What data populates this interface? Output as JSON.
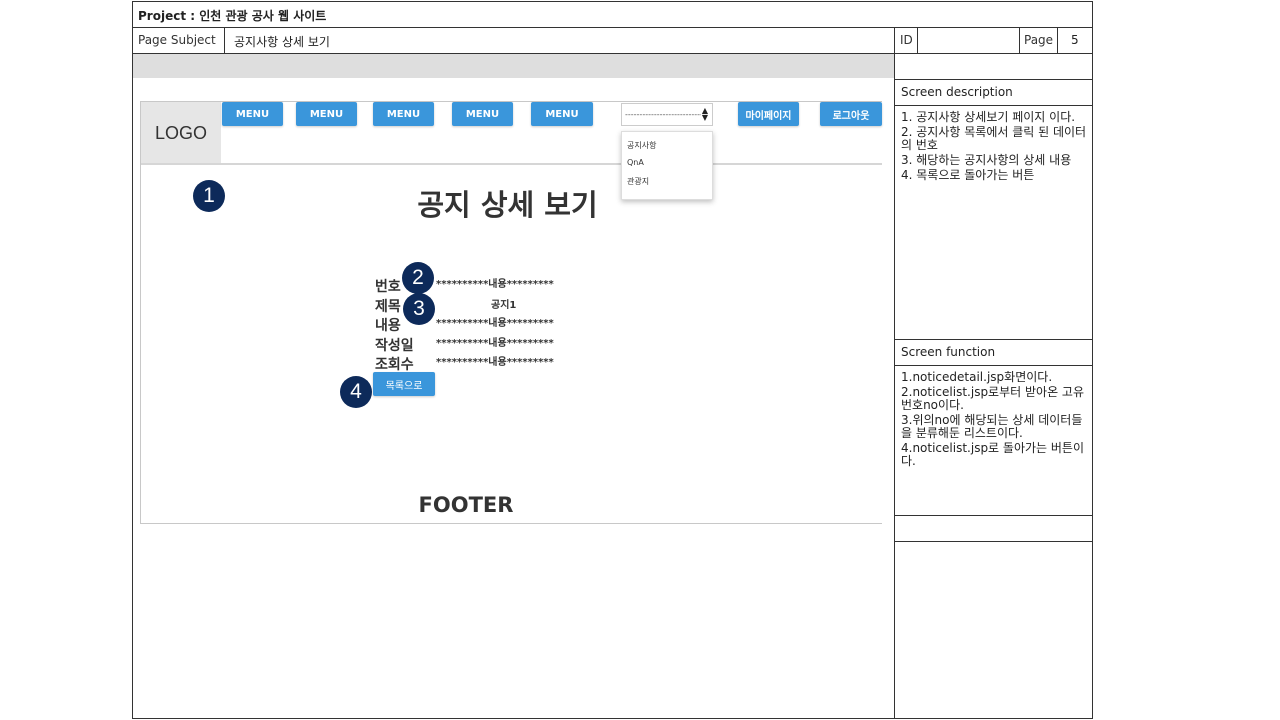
{
  "header": {
    "project_label": "Project : 인천 관광 공사 웹 사이트",
    "page_subject_label": "Page Subject",
    "page_subject_value": "공지사항 상세 보기",
    "id_label": "ID",
    "id_value": "",
    "page_label": "Page",
    "page_value": "5"
  },
  "site": {
    "logo": "LOGO",
    "nav": [
      "MENU",
      "MENU",
      "MENU",
      "MENU",
      "MENU"
    ],
    "select_value": "-----------------------------",
    "select_icon": "updown-arrows-icon",
    "dropdown_options": [
      "공지사항",
      "QnA",
      "관광지"
    ],
    "mypage_button": "마이페이지",
    "logout_button": "로그아웃",
    "page_title": "공지 상세 보기",
    "fields": [
      {
        "label": "번호",
        "value": "**********내용*********"
      },
      {
        "label": "제목",
        "value": "공지1"
      },
      {
        "label": "내용",
        "value": "**********내용*********"
      },
      {
        "label": "작성일",
        "value": "**********내용*********"
      },
      {
        "label": "조회수",
        "value": "**********내용*********"
      }
    ],
    "list_button": "목록으로",
    "footer": "FOOTER",
    "accent_color": "#3a96db"
  },
  "markers": [
    "1",
    "2",
    "3",
    "4"
  ],
  "marker_color": "#0d2a5a",
  "description": {
    "title": "Screen description",
    "items": [
      "1. 공지사항 상세보기 페이지 이다.",
      "2. 공지사항 목록에서 클릭 된 데이터의 번호",
      "3. 해당하는 공지사항의 상세 내용",
      "4. 목록으로 돌아가는 버튼"
    ]
  },
  "function": {
    "title": "Screen function",
    "items": [
      "1.noticedetail.jsp화면이다.",
      "2.noticelist.jsp로부터 받아온 고유번호no이다.",
      "3.위의no에 해당되는 상세 데이터들을 분류해둔 리스트이다.",
      "4.noticelist.jsp로 돌아가는 버튼이다."
    ]
  }
}
